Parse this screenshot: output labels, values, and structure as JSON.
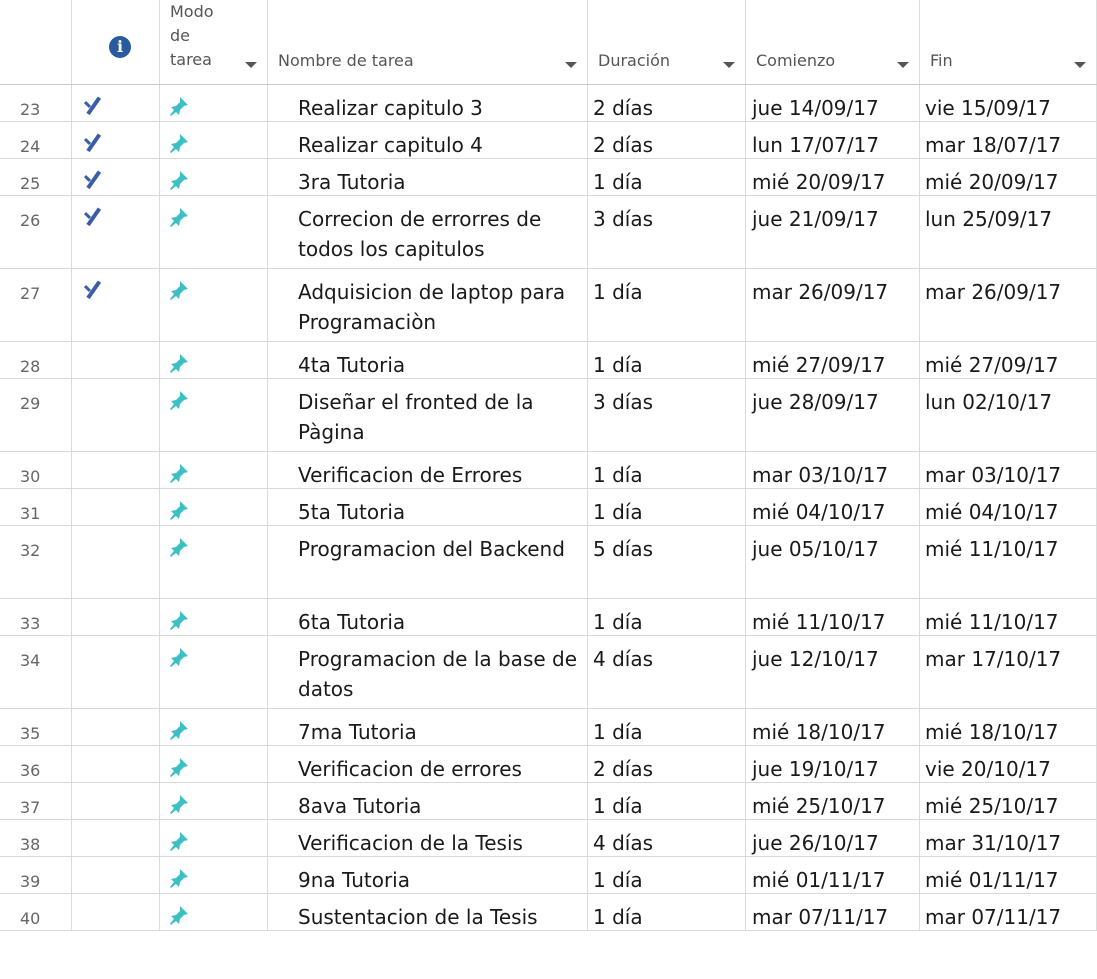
{
  "header": {
    "info_icon": "information-icon",
    "modo_label": "Modo de tarea",
    "nombre_label": "Nombre de tarea",
    "duracion_label": "Duración",
    "comienzo_label": "Comienzo",
    "fin_label": "Fin"
  },
  "colors": {
    "check": "#3b5da8",
    "pin": "#3cc0c6",
    "info": "#2a5b9e"
  },
  "rows": [
    {
      "id": "23",
      "done": true,
      "name": "Realizar  capitulo 3",
      "dur": "2 días",
      "start": "jue 14/09/17",
      "end": "vie 15/09/17"
    },
    {
      "id": "24",
      "done": true,
      "name": "Realizar capitulo 4",
      "dur": "2 días",
      "start": "lun 17/07/17",
      "end": "mar 18/07/17"
    },
    {
      "id": "25",
      "done": true,
      "name": "3ra Tutoria",
      "dur": "1 día",
      "start": "mié 20/09/17",
      "end": "mié 20/09/17"
    },
    {
      "id": "26",
      "done": true,
      "name": "Correcion de errorres de todos los capitulos",
      "dur": "3 días",
      "start": "jue 21/09/17",
      "end": "lun 25/09/17"
    },
    {
      "id": "27",
      "done": true,
      "name": "Adquisicion de laptop para Programaciòn",
      "dur": "1 día",
      "start": "mar 26/09/17",
      "end": "mar 26/09/17"
    },
    {
      "id": "28",
      "done": false,
      "name": "4ta Tutoria",
      "dur": "1 día",
      "start": "mié 27/09/17",
      "end": "mié 27/09/17"
    },
    {
      "id": "29",
      "done": false,
      "name": "Diseñar el fronted de la Pàgina",
      "dur": "3 días",
      "start": "jue 28/09/17",
      "end": "lun 02/10/17"
    },
    {
      "id": "30",
      "done": false,
      "name": "Verificacion de Errores",
      "dur": "1 día",
      "start": "mar 03/10/17",
      "end": "mar 03/10/17"
    },
    {
      "id": "31",
      "done": false,
      "name": "5ta Tutoria",
      "dur": "1 día",
      "start": "mié 04/10/17",
      "end": "mié 04/10/17"
    },
    {
      "id": "32",
      "done": false,
      "name": "Programacion del Backend",
      "dur": "5 días",
      "start": "jue 05/10/17",
      "end": "mié 11/10/17"
    },
    {
      "id": "33",
      "done": false,
      "name": "6ta Tutoria",
      "dur": "1 día",
      "start": "mié 11/10/17",
      "end": "mié 11/10/17"
    },
    {
      "id": "34",
      "done": false,
      "name": "Programacion de la base de datos",
      "dur": "4 días",
      "start": "jue 12/10/17",
      "end": "mar 17/10/17"
    },
    {
      "id": "35",
      "done": false,
      "name": "7ma Tutoria",
      "dur": "1 día",
      "start": "mié 18/10/17",
      "end": "mié 18/10/17"
    },
    {
      "id": "36",
      "done": false,
      "name": "Verificacion de errores",
      "dur": "2 días",
      "start": "jue 19/10/17",
      "end": "vie 20/10/17"
    },
    {
      "id": "37",
      "done": false,
      "name": "8ava Tutoria",
      "dur": "1 día",
      "start": "mié 25/10/17",
      "end": "mié 25/10/17"
    },
    {
      "id": "38",
      "done": false,
      "name": "Verificacion de la Tesis",
      "dur": "4 días",
      "start": "jue 26/10/17",
      "end": "mar 31/10/17"
    },
    {
      "id": "39",
      "done": false,
      "name": "9na Tutoria",
      "dur": "1 día",
      "start": "mié 01/11/17",
      "end": "mié 01/11/17"
    },
    {
      "id": "40",
      "done": false,
      "name": "Sustentacion de la Tesis",
      "dur": "1 día",
      "start": "mar 07/11/17",
      "end": "mar 07/11/17"
    }
  ]
}
